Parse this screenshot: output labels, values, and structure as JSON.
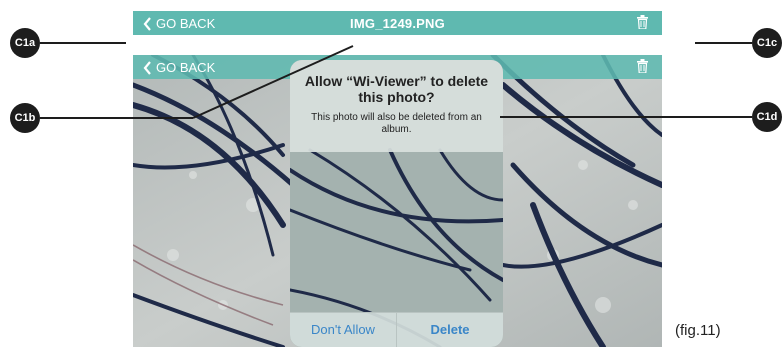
{
  "topbar": {
    "back_label": "GO BACK",
    "title": "IMG_1249.PNG",
    "back_icon": "chevron-left-icon",
    "delete_icon": "trash-icon"
  },
  "secondbar": {
    "back_label": "GO BACK",
    "back_icon": "chevron-left-icon",
    "delete_icon": "trash-icon"
  },
  "alert": {
    "title": "Allow “Wi-Viewer” to delete this photo?",
    "message": "This photo will also be deleted from an album.",
    "cancel_label": "Don't Allow",
    "confirm_label": "Delete"
  },
  "callouts": {
    "c1a": "C1a",
    "c1b": "C1b",
    "c1c": "C1c",
    "c1d": "C1d"
  },
  "caption": "(fig.11)",
  "colors": {
    "bar": "#5fb9b0",
    "button_text": "#3a86c8",
    "callout": "#1d1d1d"
  }
}
